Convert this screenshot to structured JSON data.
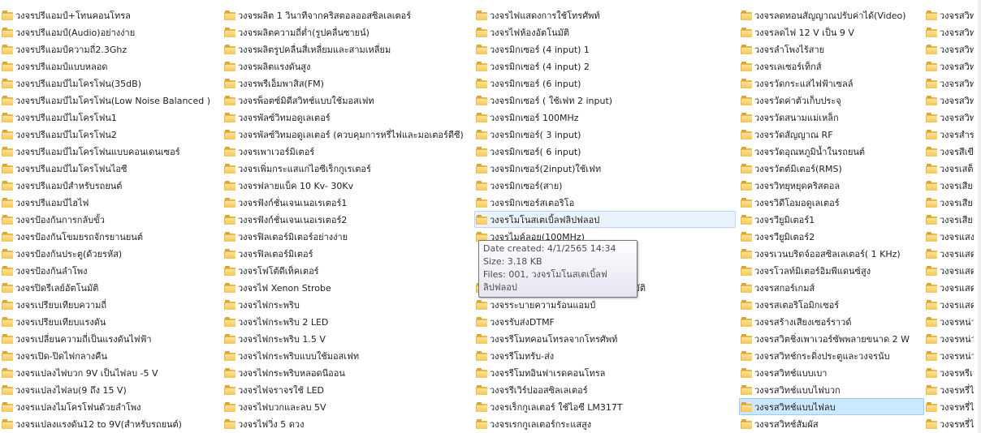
{
  "columns": [
    {
      "items": [
        "วงจรปรีแอมป์+โทนคอนโทรล",
        "วงจรปรีแอมป์(Audio)อย่างง่าย",
        "วงจรปรีแอมป์ความถี่2.3Ghz",
        "วงจรปรีแอมป์แบบหลอด",
        "วงจรปรีแอมป์ไมโครโฟน(35dB)",
        "วงจรปรีแอมป์ไมโครโฟน(Low  Noise Balanced )",
        "วงจรปรีแอมป์ไมโครโฟน1",
        "วงจรปรีแอมป์ไมโครโฟน2",
        "วงจรปรีแอมป์ไมโครโฟนแบบคอนเดนเซอร์",
        "วงจรปรีแอมป์ไมโครโฟนไอซี",
        "วงจรปรีแอมป์สำหรับรถยนต์",
        "วงจรปรีแอมป์ไฮไฟ",
        "วงจรป้องกันการกลับขั้ว",
        "วงจรป้องกันโขมยรถจักรยานยนต์",
        "วงจรป้องกันประตู(ด้วยรหัส)",
        "วงจรป้องกันลำโพง",
        "วงจรปิดรีเลย์อัตโนมัติ",
        "วงจรเปรียบเทียบความถี่",
        "วงจรเปรียบเทียบแรงดัน",
        "วงจรเปลี่ยนความถี่เป็นแรงดันไฟฟ้า",
        "วงจรเปิด-ปิดไฟกลางคืน",
        "วงจรแปลงไฟบวก 9V เป็นไฟลบ -5 V",
        "วงจรแปลงไฟลบ(9  ถึง 15 V)",
        "วงจรแปลงไมโครโฟนด้วยลำโพง",
        "วงจรแปลงแรงดัน12 to 9V(สำหรับรถยนต์)"
      ]
    },
    {
      "items": [
        "วงจรผลิต 1 วินาทีจากคริสตอลออสซิลเลเตอร์",
        "วงจรผลิตความถี่ต่ำ(รูปคลื่นซายน์)",
        "วงจรผลิตรูปคลื่นสี่เหลี่ยมและสามเหลี่ยม",
        "วงจรผลิตแรงดันสูง",
        "วงจรพรีเอ็มพาสิส(FM)",
        "วงจรพ็อตซ์มิดีสวิทช์แบบใช้มอสเฟท",
        "วงจรพัลซ์วิทมอดูเลเตอร์",
        "วงจรพัลซ์วิทมอดูเลเตอร์ (ควบคุมการหรี่ไฟและมอเตอร์ดีซี)",
        "วงจรเพาเวอร์มิเตอร์",
        "วงจรเพิ่มกระแสแก่ไอซีเร็กกูเรเตอร์",
        "วงจรฟลายแบ็ค 10 Kv- 30Kv",
        "วงจรฟังก์ชั่นเจนเนอเรเตอร์1",
        "วงจรฟังก์ชั่นเจนเนอเรเตอร์2",
        "วงจรฟิลเตอร์มิเตอร์อย่างง่าย",
        "วงจรฟิลเตอร์มิเตอร์",
        "วงจรโฟโต้ดีเท็คเตอร์",
        "วงจรไฟ Xenon Strobe",
        "วงจรไฟกระพริบ",
        "วงจรไฟกระพริบ  2  LED",
        "วงจรไฟกระพริบ 1.5 V",
        "วงจรไฟกระพริบแบบใช้มอสเฟท",
        "วงจรไฟกระพริบหลอดนีออน",
        "วงจรไฟจราจรใช้ LED",
        "วงจรไฟบวกและลบ 5V",
        "วงจรไฟวิ่ง 5  ดวง"
      ]
    },
    {
      "items": [
        "วงจรไฟแสดงการใช้โทรศัพท์",
        "วงจรไฟห้องอัตโนมัติ",
        "วงจรมิกเซอร์ (4 input) 1",
        "วงจรมิกเซอร์ (4 input) 2",
        "วงจรมิกเซอร์ (6 input)",
        "วงจรมิกเซอร์ ( ใช้เฟท 2 input)",
        "วงจรมิกเซอร์ 100MHz",
        "วงจรมิกเซอร์( 3  input)",
        "วงจรมิกเซอร์( 6 input)",
        "วงจรมิกเซอร์(2input)ใช้เฟท",
        "วงจรมิกเซอร์(สาย)",
        "วงจรมิกเซอร์สเตอริโอ",
        "วงจรโมโนสเตเบิ้ลฟลิปฟลอป",
        "วงจรไมค์ลอย(100MHz)",
        "",
        "",
        "วงจรระบายความร้อนด้วยพัดลมอัตโนมัติ",
        "วงจรระบายความร้อนแอมป์",
        "วงจรรับส่งDTMF",
        "วงจรรีโมทคอนโทรลจากโทรศัพท์",
        "วงจรรีโมทรับ-ส่ง",
        "วงจรรีโมทอินฟาเรดคอนโทรล",
        "วงจรรีเวิร์ปออสซิลเลเตอร์",
        "วงจรเร็กกูเลเตอร์ ใช้ไอซี LM317T",
        "วงจรเรกกูเลเตอร์กระแสสูง"
      ]
    },
    {
      "items": [
        "วงจรลดทอนสัญญาณปรับค่าได้(Video)",
        "วงจรลดไฟ 12 V เป็น 9 V",
        "วงจรลำโพงไร้สาย",
        "วงจรเลเซอร์เท็กส์",
        "วงจรวัดกระแสไฟฟ้าเซลล์",
        "วงจรวัดค่าตัวเก็บประจุ",
        "วงจรวัดสนามแม่เหล็ก",
        "วงจรวัดสัญญาณ RF",
        "วงจรวัดอุณหภูมิน้ำในรถยนต์",
        "วงจรวัตต์มิเตอร์(RMS)",
        "วงจรวิทยุหยุดคริสตอล",
        "วงจรวิดีโอมอดูเลเตอร์",
        "วงจรวียูมิเตอร์1",
        "วงจรวียูมิเตอร์2",
        "วงจรเวนบริดจ์ออสซิลเลเตอร์( 1 KHz)",
        "วงจรโวลท์มิเตอร์อิมพีแดนซ์สูง",
        "วงจรสกอร์เกมส์",
        "วงจรสเตอริโอมิกเซอร์",
        "วงจรสร้างเสียงเซอร์ราวด์",
        "วงจรสวิตชิ่งเพาเวอร์ซัพพลายขนาด 2 W",
        "วงจรสวิทช์กระดิ่งประตูและวงจรนับ",
        "วงจรสวิทช์แบบเบา",
        "วงจรสวิทช์แบบไฟบวก",
        "วงจรสวิทช์แบบไฟลบ",
        "วงจรสวิทช์สัมผัส"
      ]
    },
    {
      "items": [
        "วงจรสวิทช",
        "วงจรสวิทช",
        "วงจรสวิทช",
        "วงจรสวิทช",
        "วงจรสวิทช",
        "วงจรสวิทช",
        "วงจรสวิทช",
        "วงจรสำรอ",
        "วงจรสีเขีย",
        "วงจรเสต็ป",
        "วงจรเสียง",
        "วงจรเสียง",
        "วงจรเสียง",
        "วงจรแสงเ",
        "วงจรแสดง",
        "วงจรแสดง",
        "วงจรแสดง",
        "วงจรแสดง",
        "วงจรหน่วง",
        "วงจรหน่วง",
        "วงจรหน่วง",
        "วงจรหรีเว",
        "วงจรหรี่ไฟ",
        "วงจรหรี่ไฟ",
        "วงจรหรี่ไฟ"
      ]
    }
  ],
  "tooltip": {
    "date_created": "Date created: 4/1/2565 14:34",
    "size": "Size: 3.18 KB",
    "files": "Files: 001, วงจรโมโนสเตเบิ้ลฟลิปฟลอป"
  },
  "colors": {
    "folder": "#f3c654",
    "hover_bg": "#eaf3fc",
    "selected_bg": "#cce8ff"
  }
}
